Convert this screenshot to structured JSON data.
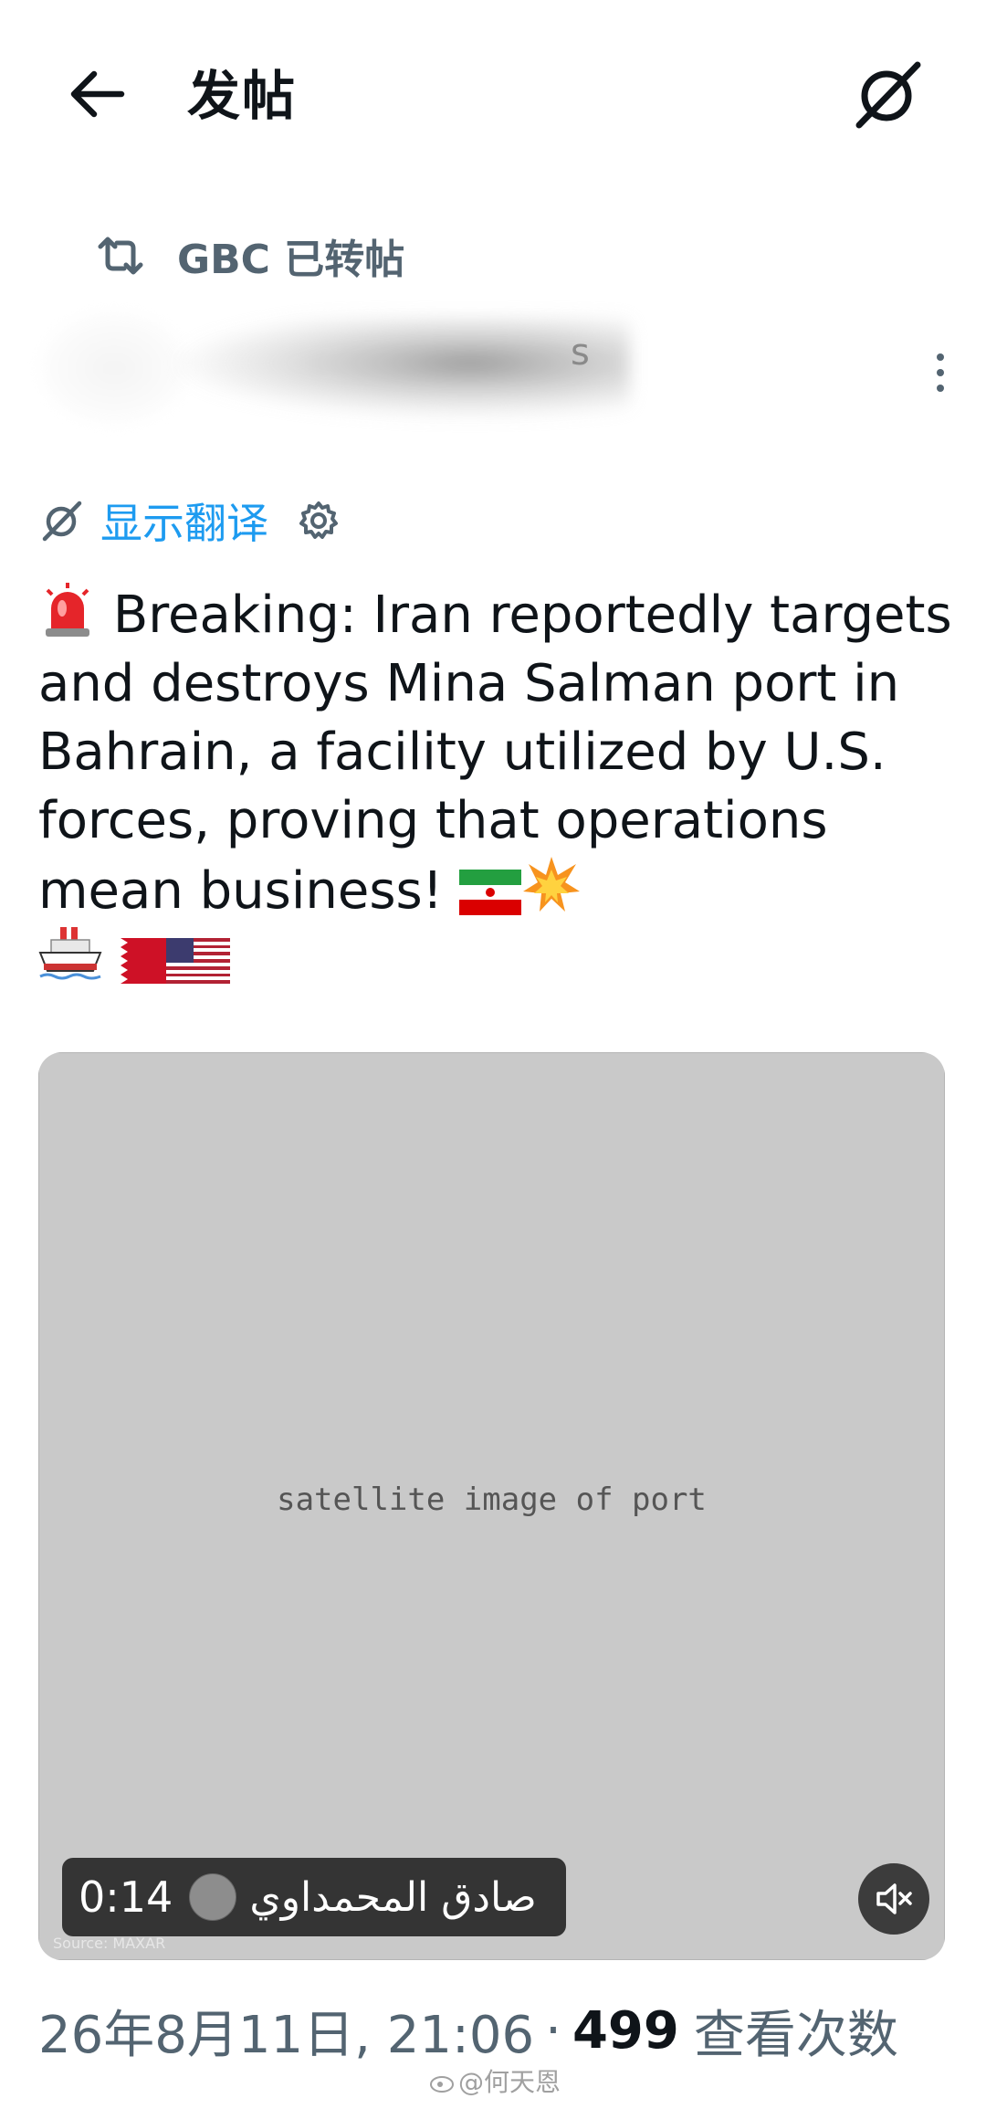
{
  "header": {
    "title": "发帖",
    "back_icon": "arrow-left-icon",
    "grok_icon": "grok-icon"
  },
  "repost": {
    "text": "GBC 已转帖",
    "icon": "repost-icon"
  },
  "author": {
    "name_trailing_char": "s",
    "more_icon": "more-vertical-icon"
  },
  "translate": {
    "label": "显示翻译",
    "icon": "grok-icon",
    "settings_icon": "gear-icon"
  },
  "tweet": {
    "text": "Breaking: Iran reportedly targets and destroys Mina Salman port in Bahrain, a facility utilized by U.S. forces, proving that operations mean business!",
    "lead_emoji": "police-light-emoji",
    "trailing_emojis": [
      "iran-flag-emoji",
      "collision-emoji"
    ],
    "tail_emojis": [
      "ship-emoji",
      "bahrain-flag-emoji",
      "usa-flag-emoji"
    ]
  },
  "media": {
    "duration": "0:14",
    "uploader": "صادق المحمداوي",
    "source_watermark": "Source: MAXAR",
    "mute_icon": "speaker-muted-icon",
    "image_label": "satellite image of port"
  },
  "meta": {
    "date": "26年8月11日, 21:06",
    "separator": "·",
    "views": "499",
    "views_label": "查看次数"
  },
  "watermark": {
    "text": "@何天恩"
  },
  "colors": {
    "link": "#1d9bf0",
    "secondary": "#536471",
    "primary_text": "#0f1419"
  }
}
